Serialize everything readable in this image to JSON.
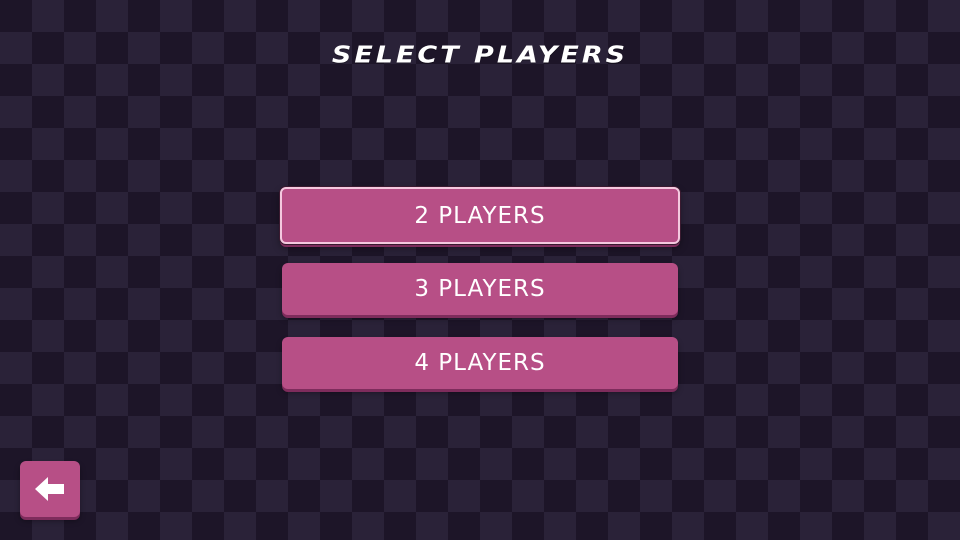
{
  "screen": {
    "title": "SELECT PLAYERS"
  },
  "menu": {
    "options": [
      {
        "label": "2 PLAYERS",
        "selected": true
      },
      {
        "label": "3 PLAYERS",
        "selected": false
      },
      {
        "label": "4 PLAYERS",
        "selected": false
      }
    ]
  },
  "back_button": {
    "icon": "arrow-left-icon"
  },
  "colors": {
    "background_dark": "#1d1528",
    "background_light": "#2a2238",
    "button": "#b74f86",
    "button_shadow": "#7e2c5c",
    "selected_border": "#f4c9df",
    "text": "#ffffff"
  }
}
